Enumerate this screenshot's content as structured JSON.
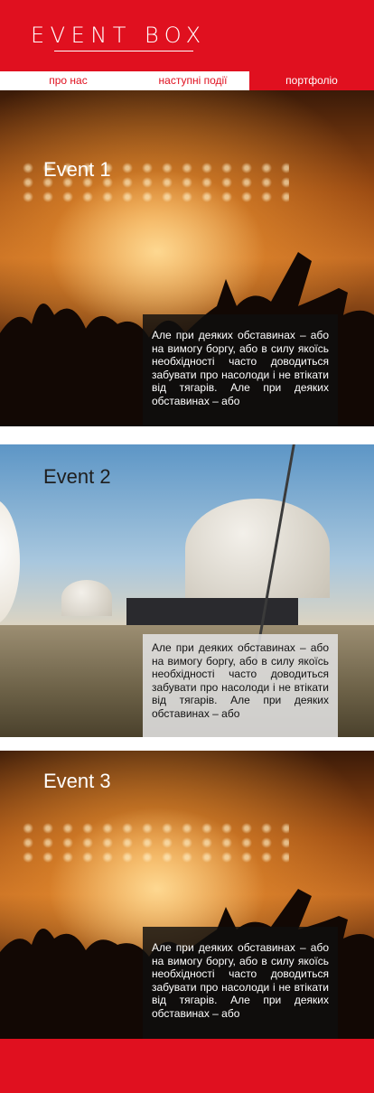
{
  "header": {
    "logo": "EVENT BOX"
  },
  "nav": [
    {
      "label": "про нас"
    },
    {
      "label": "наступні події"
    },
    {
      "label": "портфоліо"
    }
  ],
  "events": [
    {
      "title": "Event 1",
      "text": "Але при деяких обставинах – або на вимогу боргу, або в силу якоїсь необхідності часто доводиться забувати про насолоди і не втікати від тягарів. Але при деяких обставинах – або"
    },
    {
      "title": "Event 2",
      "text": "Але при деяких обставинах – або на вимогу боргу, або в силу якоїсь необхідності часто доводиться забувати про насолоди і не втікати від тягарів. Але при деяких обставинах – або"
    },
    {
      "title": "Event 3",
      "text": "Але при деяких обставинах – або на вимогу боргу, або в силу якоїсь необхідності часто доводиться забувати про насолоди і не втікати від тягарів. Але при деяких обставинах – або"
    }
  ],
  "colors": {
    "brand_red": "#e0101f"
  }
}
